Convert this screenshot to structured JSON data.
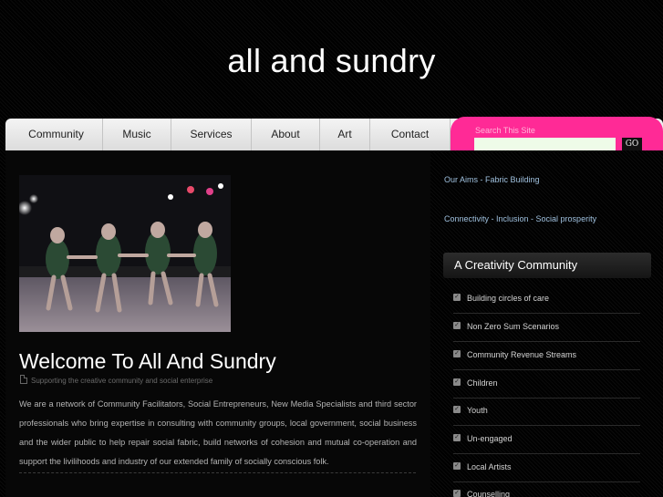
{
  "site": {
    "title": "all and sundry"
  },
  "nav": {
    "items": [
      {
        "label": "Community"
      },
      {
        "label": "Music"
      },
      {
        "label": "Services"
      },
      {
        "label": "About"
      },
      {
        "label": "Art"
      },
      {
        "label": "Contact"
      }
    ]
  },
  "search": {
    "label": "Search This Site",
    "button": "GO",
    "value": ""
  },
  "post": {
    "title": "Welcome To All And Sundry",
    "meta": "Supporting the creative community and social enterprise",
    "body": "We are a network of Community Facilitators, Social Entrepreneurs, New Media Specialists and third sector professionals who bring expertise in consulting with community groups, local government, social business and the wider public to help repair social fabric, build networks of cohesion and mutual co-operation and support the livilihoods and industry of our extended family of socially conscious folk."
  },
  "sidebar": {
    "links": [
      {
        "label": "Our Aims - Fabric Building"
      },
      {
        "label": "Connectivity - Inclusion - Social prosperity"
      }
    ],
    "widget": {
      "title": "A Creativity Community",
      "items": [
        {
          "label": "Building circles of care"
        },
        {
          "label": "Non Zero Sum Scenarios"
        },
        {
          "label": "Community Revenue Streams"
        },
        {
          "label": "Children"
        },
        {
          "label": "Youth"
        },
        {
          "label": "Un-engaged"
        },
        {
          "label": "Local Artists"
        },
        {
          "label": "Counselling"
        }
      ]
    }
  },
  "colors": {
    "accent": "#ff2a96",
    "link": "#9fc0de",
    "background": "#000000"
  }
}
